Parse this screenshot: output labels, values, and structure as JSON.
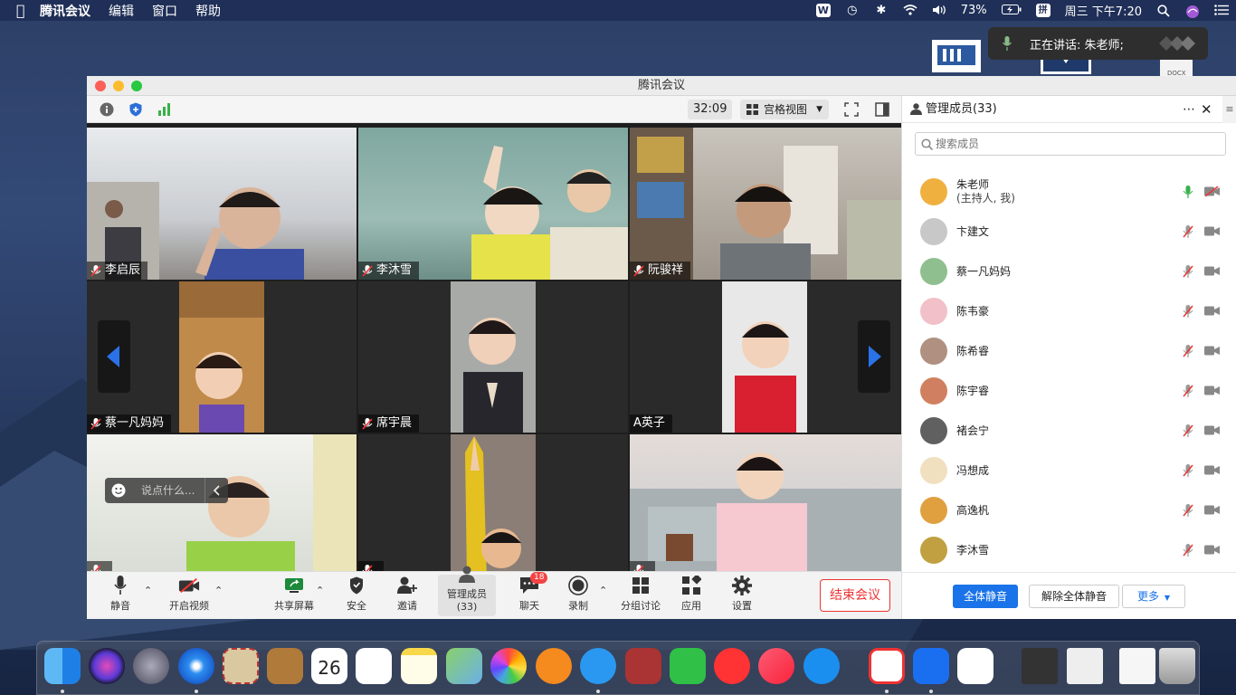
{
  "menubar": {
    "app_name": "腾讯会议",
    "menus": [
      "编辑",
      "窗口",
      "帮助"
    ],
    "battery": "73%",
    "datetime": "周三 下午7:20"
  },
  "notification": {
    "text": "正在讲话: 朱老师;"
  },
  "window": {
    "title": "腾讯会议",
    "timer": "32:09",
    "view_mode": "宫格视图"
  },
  "tiles": [
    {
      "name": "李启辰",
      "muted": true
    },
    {
      "name": "李沐雪",
      "muted": true
    },
    {
      "name": "阮骏祥",
      "muted": true
    },
    {
      "name": "蔡一凡妈妈",
      "muted": true
    },
    {
      "name": "席宇晨",
      "muted": true
    },
    {
      "name": "A英子",
      "muted": false
    },
    {
      "name": "",
      "muted": true
    },
    {
      "name": "",
      "muted": true
    },
    {
      "name": "",
      "muted": true
    }
  ],
  "chat_input": {
    "placeholder": "说点什么..."
  },
  "bottombar": {
    "mute": "静音",
    "video": "开启视频",
    "share": "共享屏幕",
    "security": "安全",
    "invite": "邀请",
    "members": "管理成员(33)",
    "chat": "聊天",
    "chat_badge": "18",
    "record": "录制",
    "breakout": "分组讨论",
    "apps": "应用",
    "settings": "设置",
    "end": "结束会议"
  },
  "panel": {
    "title": "管理成员(33)",
    "search_placeholder": "搜索成员",
    "members": [
      {
        "name": "朱老师",
        "role": "(主持人, 我)",
        "mic": "on",
        "avatar_color": "#f0b040"
      },
      {
        "name": "卞建文",
        "role": "",
        "mic": "off",
        "avatar_color": "#c8c8c8"
      },
      {
        "name": "蔡一凡妈妈",
        "role": "",
        "mic": "off",
        "avatar_color": "#8fbf8f"
      },
      {
        "name": "陈韦豪",
        "role": "",
        "mic": "off",
        "avatar_color": "#f2c0c8"
      },
      {
        "name": "陈希睿",
        "role": "",
        "mic": "off",
        "avatar_color": "#b09080"
      },
      {
        "name": "陈宇睿",
        "role": "",
        "mic": "off",
        "avatar_color": "#d08060"
      },
      {
        "name": "褚会宁",
        "role": "",
        "mic": "off",
        "avatar_color": "#606060"
      },
      {
        "name": "冯想成",
        "role": "",
        "mic": "off",
        "avatar_color": "#f0e0c0"
      },
      {
        "name": "高逸杋",
        "role": "",
        "mic": "off",
        "avatar_color": "#e0a040"
      },
      {
        "name": "李沐雪",
        "role": "",
        "mic": "off",
        "avatar_color": "#c0a040"
      }
    ],
    "mute_all": "全体静音",
    "unmute_all": "解除全体静音",
    "more": "更多"
  },
  "colors": {
    "accent": "#1a73e8",
    "danger": "#e33333",
    "mic_on": "#3ab04a"
  }
}
